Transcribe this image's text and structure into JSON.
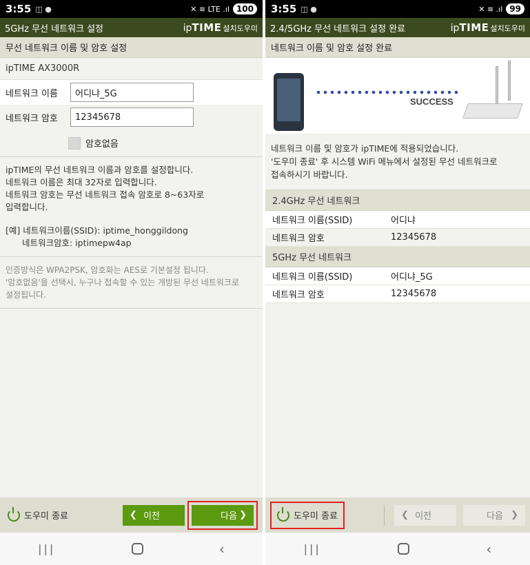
{
  "left": {
    "status": {
      "time": "3:55",
      "icons": "◫ ●",
      "signal": "✕ ≋ LTE .ıl",
      "battery": "100"
    },
    "title": "5GHz 무선 네트워크 설정",
    "brand": {
      "ip": "ip",
      "time": "TIME",
      "helper": "설치도우미"
    },
    "section": "무선 네트워크 이름 및 암호 설정",
    "model": "ipTIME AX3000R",
    "network_name": {
      "label": "네트워크 이름",
      "value": "어디냐_5G"
    },
    "network_password": {
      "label": "네트워크 암호",
      "value": "12345678"
    },
    "no_password_label": "암호없음",
    "desc": [
      "ipTIME의 무선 네트워크 이름과 암호를 설정합니다.",
      "네트워크 이름은 최대 32자로 입력합니다.",
      "네트워크 암호는 무선 네트워크 접속 암호로 8~63자로",
      "입력합니다."
    ],
    "example_line1": "[예] 네트워크이름(SSID): iptime_honggildong",
    "example_line2": "네트워크암호: iptimepw4ap",
    "note": [
      "인증방식은 WPA2PSK, 암호화는 AES로 기본설정 됩니다.",
      "'암호없음'을 선택시, 누구나 접속할 수 있는 개방된 무선 네트워크로",
      "설정됩니다."
    ],
    "exit_label": "도우미 종료",
    "prev_label": "이전",
    "next_label": "다음"
  },
  "right": {
    "status": {
      "time": "3:55",
      "icons": "◫ ●",
      "signal": "✕ ≋ .ıl",
      "battery": "99"
    },
    "title": "2.4/5GHz 무선 네트워크 설정 완료",
    "brand": {
      "ip": "ip",
      "time": "TIME",
      "helper": "설치도우미"
    },
    "section": "네트워크 이름 및 암호 설정 완료",
    "success_label": "SUCCESS",
    "info": [
      "네트워크 이름 및 암호가 ipTIME에 적용되었습니다.",
      "'도우미 종료' 후 시스템 WiFi 메뉴에서 설정된 무선 네트워크로",
      "접속하시기 바랍니다."
    ],
    "band24": {
      "header": "2.4GHz 무선 네트워크",
      "ssid_label": "네트워크 이름(SSID)",
      "ssid_value": "어디냐",
      "pw_label": "네트워크 암호",
      "pw_value": "12345678"
    },
    "band5": {
      "header": "5GHz 무선 네트워크",
      "ssid_label": "네트워크 이름(SSID)",
      "ssid_value": "어디냐_5G",
      "pw_label": "네트워크 암호",
      "pw_value": "12345678"
    },
    "exit_label": "도우미 종료",
    "prev_label": "이전",
    "next_label": "다음"
  },
  "sysnav": {
    "recent": "|||",
    "back": "‹"
  },
  "colors": {
    "title_bg": "#3c4a1f",
    "accent_green": "#5c9a10",
    "highlight_red": "#e02020"
  }
}
